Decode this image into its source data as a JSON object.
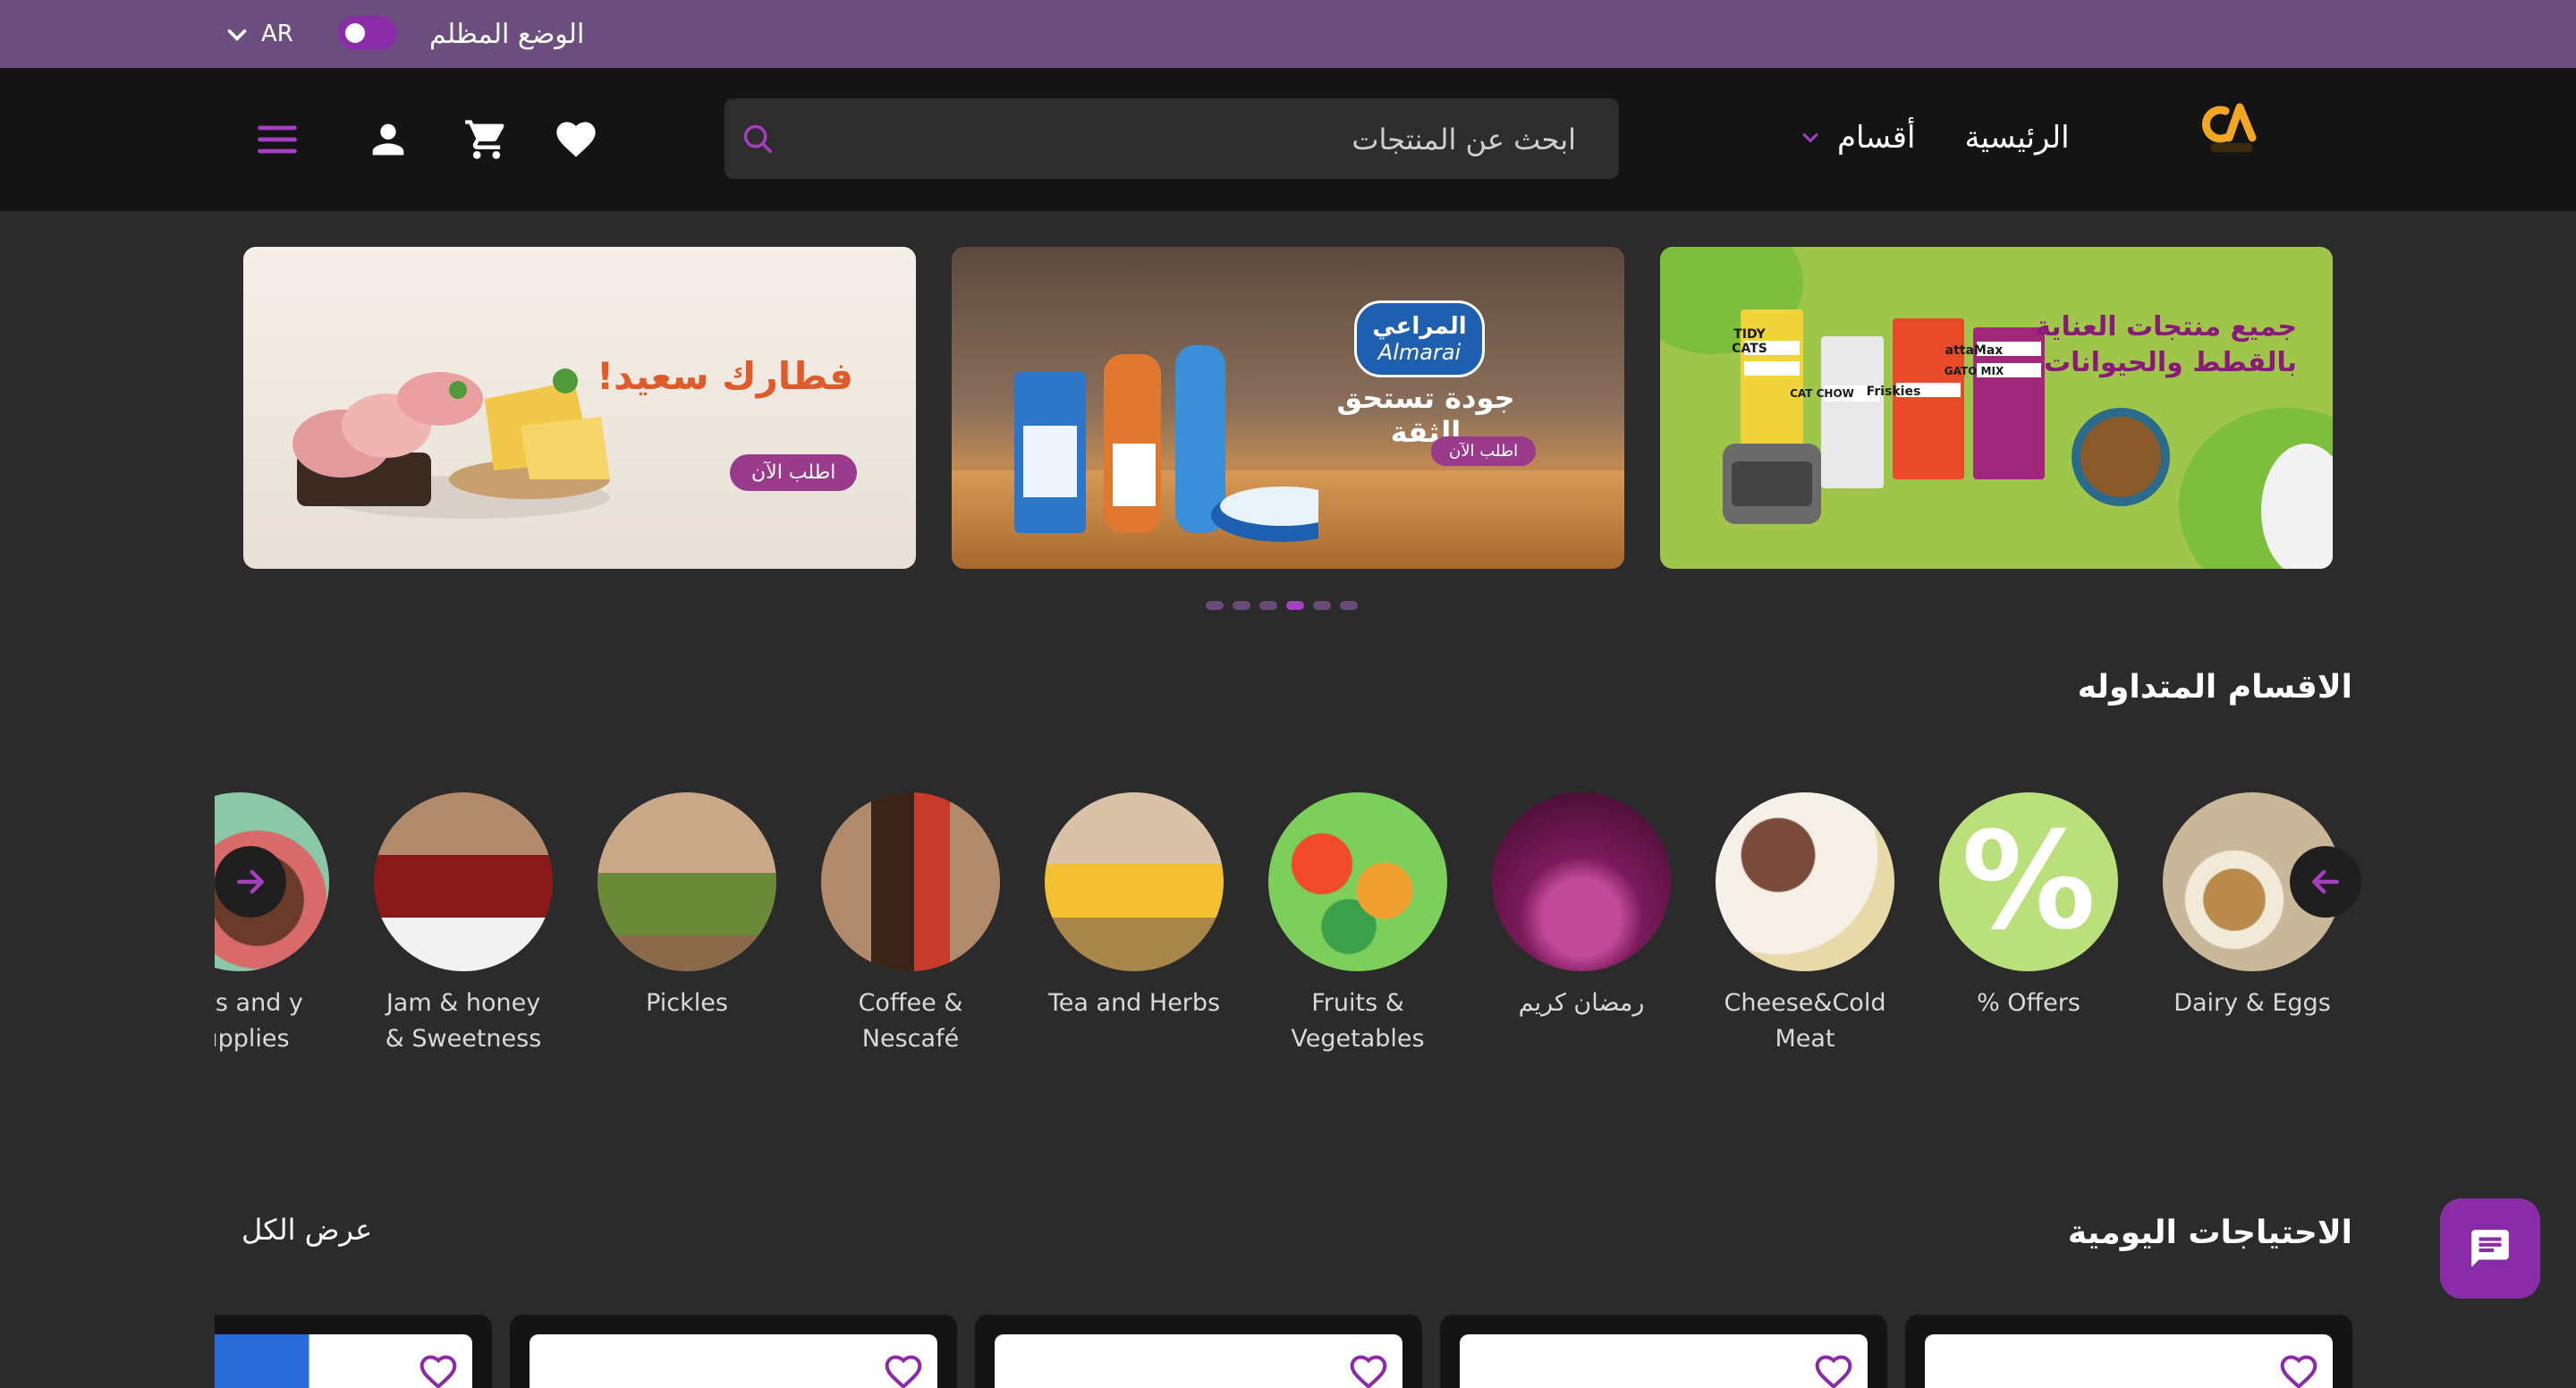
{
  "topbar": {
    "language": "AR",
    "dark_mode_label": "الوضع المظلم",
    "dark_mode_on": true
  },
  "header": {
    "nav_home": "الرئيسية",
    "nav_categories": "أقسام",
    "search_placeholder": "ابحث عن المنتجات"
  },
  "banners": [
    {
      "headline": "جميع منتجات العناية بالقطط والحيوانات",
      "brand_text": [
        "TIDY CATS",
        "CAT CHOW",
        "Friskies",
        "attaMax",
        "GATO MIX"
      ]
    },
    {
      "headline": "جودة تستحق الثقة",
      "brand": "المراعي",
      "brand_latin": "Almarai",
      "button": "اطلب الآن"
    },
    {
      "headline": "فطارك سعيد!",
      "button": "اطلب الآن"
    }
  ],
  "carousel": {
    "count": 6,
    "active_index": 3
  },
  "trending": {
    "title": "الاقسام المتداوله",
    "categories": [
      {
        "label": "Dairy & Eggs",
        "icon": "dairy-eggs"
      },
      {
        "label": "% Offers",
        "icon": "percent-offers"
      },
      {
        "label": "Cheese&Cold Meat",
        "icon": "cheese-meat"
      },
      {
        "label": "رمضان كريم",
        "icon": "ramadan"
      },
      {
        "label": "Fruits & Vegetables",
        "icon": "fruits-vegetables"
      },
      {
        "label": "Tea and Herbs",
        "icon": "tea-herbs"
      },
      {
        "label": "Coffee & Nescafé",
        "icon": "coffee"
      },
      {
        "label": "Pickles",
        "icon": "pickles"
      },
      {
        "label": "Jam & honey & Sweetness",
        "icon": "jam-honey"
      },
      {
        "label": "eets and y supplies",
        "icon": "sweets"
      }
    ]
  },
  "daily_needs": {
    "title": "الاحتياجات اليومية",
    "see_all": "عرض الكل"
  },
  "colors": {
    "accent": "#8a2ca8",
    "topbar": "#6b4e7d",
    "header": "#141414",
    "background": "#2b2b2b"
  }
}
